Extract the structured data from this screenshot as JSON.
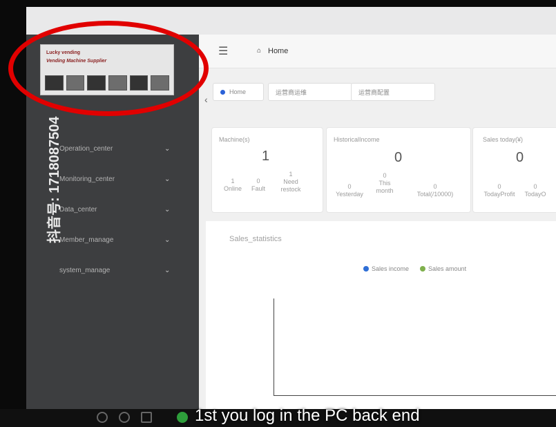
{
  "breadcrumb": {
    "home_label": "Home"
  },
  "sidebar": {
    "items": [
      {
        "label": "Operation_center"
      },
      {
        "label": "Monitoring_center"
      },
      {
        "label": "Data_center"
      },
      {
        "label": "Member_manage"
      },
      {
        "label": "system_manage"
      }
    ]
  },
  "tabs": [
    {
      "label": "Home"
    },
    {
      "label": "运营商运维"
    },
    {
      "label": "运营商配置"
    }
  ],
  "cards": {
    "machines": {
      "title": "Machine(s)",
      "total": "1",
      "stats": [
        {
          "value": "1",
          "label": "Online"
        },
        {
          "value": "0",
          "label": "Fault"
        },
        {
          "value": "1",
          "label": "Need restock"
        }
      ]
    },
    "historical": {
      "title": "HistoricalIncome",
      "total": "0",
      "stats": [
        {
          "value": "0",
          "label": "Yesterday"
        },
        {
          "value": "0",
          "label": "This month"
        },
        {
          "value": "0",
          "label": "Total(/10000)"
        }
      ]
    },
    "sales_today": {
      "title": "Sales today(¥)",
      "total": "0",
      "stats": [
        {
          "value": "0",
          "label": "TodayProfit"
        },
        {
          "value": "0",
          "label": "TodayO"
        }
      ]
    }
  },
  "sales_statistics": {
    "title": "Sales_statistics",
    "legend": [
      {
        "label": "Sales income",
        "color": "#2f6fd6"
      },
      {
        "label": "Sales amount",
        "color": "#7fb04d"
      }
    ]
  },
  "watermark": "抖音号: 1718087504",
  "caption": "1st you log in the PC back end"
}
